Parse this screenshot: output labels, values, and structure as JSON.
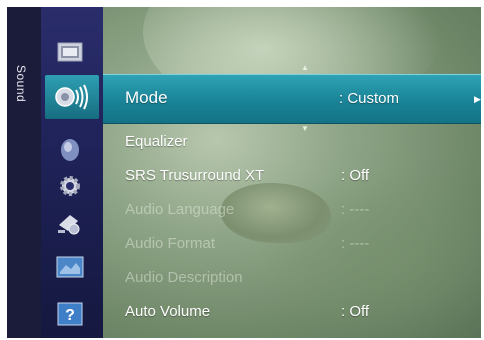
{
  "side_tab": {
    "label": "Sound"
  },
  "icons": [
    "picture-icon",
    "sound-icon",
    "channel-icon",
    "setup-icon",
    "input-icon",
    "application-icon",
    "support-icon"
  ],
  "menu": {
    "selected": {
      "label": "Mode",
      "value": ": Custom"
    },
    "items": [
      {
        "label": "Equalizer",
        "value": ""
      },
      {
        "label": "SRS Trusurround XT",
        "value": ": Off"
      },
      {
        "label": "Audio Language",
        "value": ": ----"
      },
      {
        "label": "Audio Format",
        "value": ": ----"
      },
      {
        "label": "Audio Description",
        "value": ""
      },
      {
        "label": "Auto Volume",
        "value": ": Off"
      }
    ]
  },
  "colors": {
    "highlight": "#1a8397",
    "icon_column": "#1e2257"
  }
}
